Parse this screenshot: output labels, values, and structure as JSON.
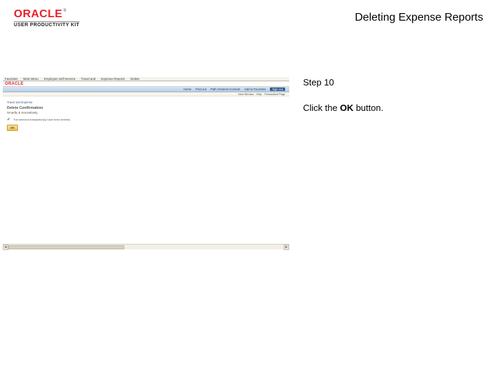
{
  "header": {
    "logo_text": "ORACLE",
    "logo_tm": "®",
    "product_line": "USER PRODUCTIVITY KIT",
    "title": "Deleting Expense Reports"
  },
  "instruction": {
    "step_label": "Step 10",
    "prefix": "Click the ",
    "bold": "OK",
    "suffix": " button."
  },
  "screenshot": {
    "tabs": [
      "Favorites",
      "Main Menu",
      "Employee Self-Service",
      "Travel and",
      "Expense Reports",
      "Delete"
    ],
    "mini_logo": "ORACLE",
    "nav_items": [
      "Home",
      "Find out",
      "Path Channel Console",
      "Add to Favorites",
      "Sign out"
    ],
    "subbar_items": [
      "New Window",
      "Help",
      "Personalize Page"
    ],
    "breadcrumb": "Travel and Expense",
    "heading": "Delete Confirmation",
    "subheading": "Smartly & Innovatively",
    "confirm_msg": "The selected transaction(s) have been deleted.",
    "ok_button": "OK",
    "scroll_left": "◄",
    "scroll_right": "►"
  }
}
